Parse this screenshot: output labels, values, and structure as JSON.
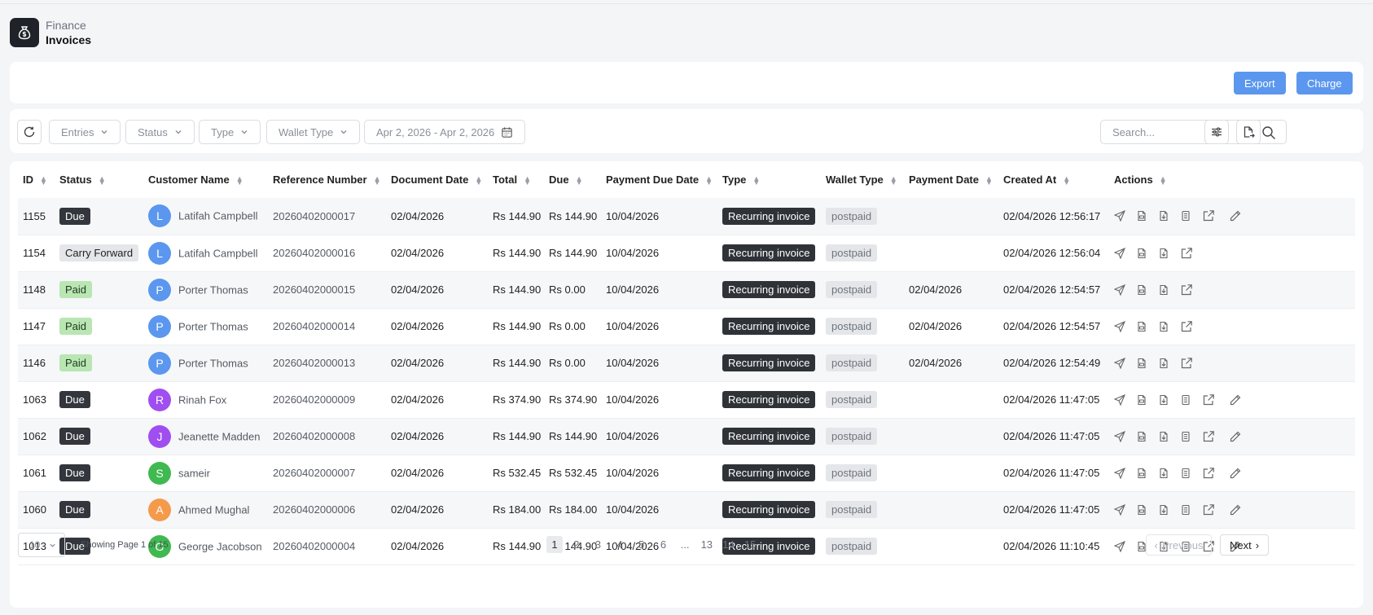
{
  "header": {
    "parent": "Finance",
    "title": "Invoices"
  },
  "toolbar": {
    "export_label": "Export",
    "charge_label": "Charge"
  },
  "filters": {
    "entries": "Entries",
    "status": "Status",
    "type": "Type",
    "wallet_type": "Wallet Type",
    "date_range": "Apr 2, 2026 - Apr 2, 2026",
    "search_placeholder": "Search..."
  },
  "table": {
    "columns": [
      "ID",
      "Status",
      "Customer Name",
      "Reference Number",
      "Document Date",
      "Total",
      "Due",
      "Payment Due Date",
      "Type",
      "Wallet Type",
      "Payment Date",
      "Created At",
      "Actions"
    ],
    "rows": [
      {
        "id": "1155",
        "status": "Due",
        "initial": "L",
        "avatar_color": "#5b97ee",
        "customer": "Latifah Campbell",
        "ref": "20260402000017",
        "doc_date": "02/04/2026",
        "total": "Rs 144.90",
        "due": "Rs 144.90",
        "pay_due": "10/04/2026",
        "type": "Recurring invoice",
        "wallet": "postpaid",
        "pay_date": "",
        "created": "02/04/2026 12:56:17"
      },
      {
        "id": "1154",
        "status": "Carry Forward",
        "initial": "L",
        "avatar_color": "#5b97ee",
        "customer": "Latifah Campbell",
        "ref": "20260402000016",
        "doc_date": "02/04/2026",
        "total": "Rs 144.90",
        "due": "Rs 144.90",
        "pay_due": "10/04/2026",
        "type": "Recurring invoice",
        "wallet": "postpaid",
        "pay_date": "",
        "created": "02/04/2026 12:56:04"
      },
      {
        "id": "1148",
        "status": "Paid",
        "initial": "P",
        "avatar_color": "#5b97ee",
        "customer": "Porter Thomas",
        "ref": "20260402000015",
        "doc_date": "02/04/2026",
        "total": "Rs 144.90",
        "due": "Rs 0.00",
        "pay_due": "10/04/2026",
        "type": "Recurring invoice",
        "wallet": "postpaid",
        "pay_date": "02/04/2026",
        "created": "02/04/2026 12:54:57"
      },
      {
        "id": "1147",
        "status": "Paid",
        "initial": "P",
        "avatar_color": "#5b97ee",
        "customer": "Porter Thomas",
        "ref": "20260402000014",
        "doc_date": "02/04/2026",
        "total": "Rs 144.90",
        "due": "Rs 0.00",
        "pay_due": "10/04/2026",
        "type": "Recurring invoice",
        "wallet": "postpaid",
        "pay_date": "02/04/2026",
        "created": "02/04/2026 12:54:57"
      },
      {
        "id": "1146",
        "status": "Paid",
        "initial": "P",
        "avatar_color": "#5b97ee",
        "customer": "Porter Thomas",
        "ref": "20260402000013",
        "doc_date": "02/04/2026",
        "total": "Rs 144.90",
        "due": "Rs 0.00",
        "pay_due": "10/04/2026",
        "type": "Recurring invoice",
        "wallet": "postpaid",
        "pay_date": "02/04/2026",
        "created": "02/04/2026 12:54:49"
      },
      {
        "id": "1063",
        "status": "Due",
        "initial": "R",
        "avatar_color": "#a04ef0",
        "customer": "Rinah Fox",
        "ref": "20260402000009",
        "doc_date": "02/04/2026",
        "total": "Rs 374.90",
        "due": "Rs 374.90",
        "pay_due": "10/04/2026",
        "type": "Recurring invoice",
        "wallet": "postpaid",
        "pay_date": "",
        "created": "02/04/2026 11:47:05"
      },
      {
        "id": "1062",
        "status": "Due",
        "initial": "J",
        "avatar_color": "#a04ef0",
        "customer": "Jeanette Madden",
        "ref": "20260402000008",
        "doc_date": "02/04/2026",
        "total": "Rs 144.90",
        "due": "Rs 144.90",
        "pay_due": "10/04/2026",
        "type": "Recurring invoice",
        "wallet": "postpaid",
        "pay_date": "",
        "created": "02/04/2026 11:47:05"
      },
      {
        "id": "1061",
        "status": "Due",
        "initial": "S",
        "avatar_color": "#3fb950",
        "customer": "sameir",
        "ref": "20260402000007",
        "doc_date": "02/04/2026",
        "total": "Rs 532.45",
        "due": "Rs 532.45",
        "pay_due": "10/04/2026",
        "type": "Recurring invoice",
        "wallet": "postpaid",
        "pay_date": "",
        "created": "02/04/2026 11:47:05"
      },
      {
        "id": "1060",
        "status": "Due",
        "initial": "A",
        "avatar_color": "#f59a4a",
        "customer": "Ahmed Mughal",
        "ref": "20260402000006",
        "doc_date": "02/04/2026",
        "total": "Rs 184.00",
        "due": "Rs 184.00",
        "pay_due": "10/04/2026",
        "type": "Recurring invoice",
        "wallet": "postpaid",
        "pay_date": "",
        "created": "02/04/2026 11:47:05"
      },
      {
        "id": "1013",
        "status": "Due",
        "initial": "G",
        "avatar_color": "#3fb950",
        "customer": "George Jacobson",
        "ref": "20260402000004",
        "doc_date": "02/04/2026",
        "total": "Rs 144.90",
        "due": "Rs 144.90",
        "pay_due": "10/04/2026",
        "type": "Recurring invoice",
        "wallet": "postpaid",
        "pay_date": "",
        "created": "02/04/2026 11:10:45"
      }
    ]
  },
  "pagination": {
    "page_size": "10",
    "showing": "Showing Page 1 of 15",
    "pages": [
      "1",
      "2",
      "3",
      "4",
      "5",
      "6",
      "...",
      "13",
      "14",
      "15"
    ],
    "current": "1",
    "previous": "Previous",
    "next": "Next"
  },
  "icons": {
    "app": "money-bag-icon",
    "refresh": "refresh-icon",
    "calendar": "calendar-icon",
    "search": "search-icon",
    "filter_settings": "sliders-icon",
    "export_file": "file-export-icon",
    "actions": [
      "send-icon",
      "pdf-icon",
      "download-icon",
      "receipt-icon",
      "open-external-icon",
      "edit-icon"
    ]
  },
  "colors": {
    "primary": "#5b97ee",
    "badge_due": "#33373d",
    "badge_paid": "#b9e6b3",
    "badge_carry": "#e4e6e9"
  }
}
